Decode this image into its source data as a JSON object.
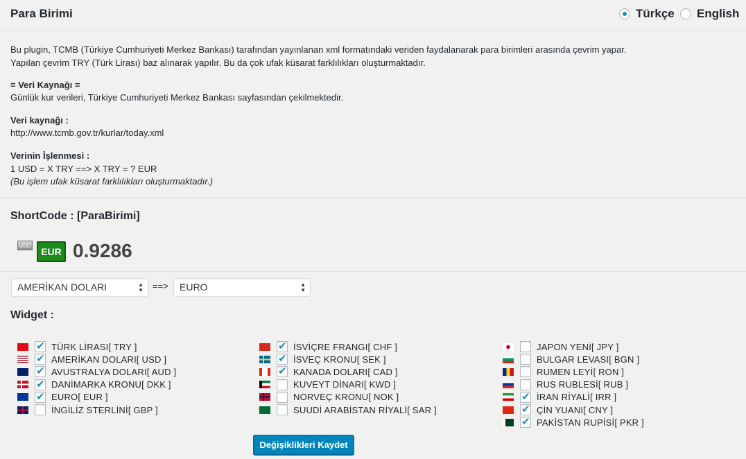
{
  "header": {
    "title": "Para Birimi",
    "lang_tr": "Türkçe",
    "lang_en": "English",
    "selected_lang": "tr"
  },
  "description": {
    "line1": "Bu plugin, TCMB (Türkiye Cumhuriyeti Merkez Bankası) tarafından yayınlanan xml formatındaki veriden faydalanarak para birimleri arasında çevrim yapar.",
    "line2": "Yapılan çevrim TRY (Türk Lirası) baz alınarak yapılır. Bu da çok ufak küsarat farklılıkları oluşturmaktadır.",
    "source_heading": "= Veri Kaynağı =",
    "source_text": "Günlük kur verileri, Türkiye Cumhuriyeti Merkez Bankası sayfasından çekilmektedir.",
    "source_label": "Veri kaynağı :",
    "source_url": "http://www.tcmb.gov.tr/kurlar/today.xml",
    "process_label": "Verinin İşlenmesi :",
    "process_text": "1 USD = X TRY ==> X TRY = ? EUR",
    "process_note": "(Bu işlem ufak küsarat farklılıkları oluşturmaktadır.)"
  },
  "shortcode": {
    "heading": "ShortCode : [ParaBirimi]",
    "from_badge": "USD",
    "to_badge": "EUR",
    "rate": "0.9286"
  },
  "converter": {
    "from_value": "AMERİKAN DOLARI",
    "arrow": "==>",
    "to_value": "EURO"
  },
  "widget": {
    "heading": "Widget :",
    "columns": [
      [
        {
          "label": "TÜRK LİRASI[ TRY ]",
          "checked": true,
          "flag": "tr"
        },
        {
          "label": "AMERİKAN DOLARI[ USD ]",
          "checked": true,
          "flag": "us"
        },
        {
          "label": "AVUSTRALYA DOLARI[ AUD ]",
          "checked": true,
          "flag": "au"
        },
        {
          "label": "DANİMARKA KRONU[ DKK ]",
          "checked": true,
          "flag": "dk"
        },
        {
          "label": "EURO[ EUR ]",
          "checked": true,
          "flag": "eu"
        },
        {
          "label": "İNGİLİZ STERLİNİ[ GBP ]",
          "checked": false,
          "flag": "gb"
        }
      ],
      [
        {
          "label": "İSVİÇRE FRANGI[ CHF ]",
          "checked": true,
          "flag": "ch"
        },
        {
          "label": "İSVEÇ KRONU[ SEK ]",
          "checked": true,
          "flag": "se"
        },
        {
          "label": "KANADA DOLARI[ CAD ]",
          "checked": true,
          "flag": "ca"
        },
        {
          "label": "KUVEYT DİNARI[ KWD ]",
          "checked": false,
          "flag": "kw"
        },
        {
          "label": "NORVEÇ KRONU[ NOK ]",
          "checked": false,
          "flag": "no"
        },
        {
          "label": "SUUDİ ARABİSTAN RİYALİ[ SAR ]",
          "checked": false,
          "flag": "sa"
        }
      ],
      [
        {
          "label": "JAPON YENİ[ JPY ]",
          "checked": false,
          "flag": "jp"
        },
        {
          "label": "BULGAR LEVASI[ BGN ]",
          "checked": false,
          "flag": "bg"
        },
        {
          "label": "RUMEN LEYİ[ RON ]",
          "checked": false,
          "flag": "ro"
        },
        {
          "label": "RUS RUBLESİ[ RUB ]",
          "checked": false,
          "flag": "ru"
        },
        {
          "label": "İRAN RİYALİ[ IRR ]",
          "checked": true,
          "flag": "ir"
        },
        {
          "label": "ÇİN YUANI[ CNY ]",
          "checked": true,
          "flag": "cn"
        },
        {
          "label": "PAKİSTAN RUPİSİ[ PKR ]",
          "checked": true,
          "flag": "pk"
        }
      ]
    ]
  },
  "save_button": "Değişiklikleri Kaydet"
}
